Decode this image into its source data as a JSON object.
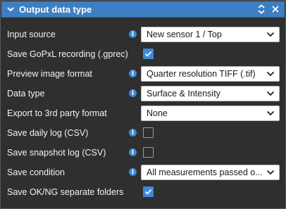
{
  "panel": {
    "title": "Output data type",
    "accent_color": "#3d7fc4"
  },
  "rows": [
    {
      "label": "Input source",
      "type": "select",
      "value": "New sensor 1 / Top",
      "info": true
    },
    {
      "label": "Save GoPxL recording (.gprec)",
      "type": "checkbox",
      "checked": true,
      "info": false
    },
    {
      "label": "Preview image format",
      "type": "select",
      "value": "Quarter resolution TIFF (.tif)",
      "info": true
    },
    {
      "label": "Data type",
      "type": "select",
      "value": "Surface & Intensity",
      "info": true
    },
    {
      "label": "Export to 3rd party format",
      "type": "select",
      "value": "None",
      "info": false
    },
    {
      "label": "Save daily log (CSV)",
      "type": "checkbox",
      "checked": false,
      "info": true
    },
    {
      "label": "Save snapshot log (CSV)",
      "type": "checkbox",
      "checked": false,
      "info": true
    },
    {
      "label": "Save condition",
      "type": "select",
      "value": "All measurements passed o...",
      "info": true
    },
    {
      "label": "Save OK/NG separate folders",
      "type": "checkbox",
      "checked": true,
      "info": false
    }
  ],
  "info_glyph": "i"
}
